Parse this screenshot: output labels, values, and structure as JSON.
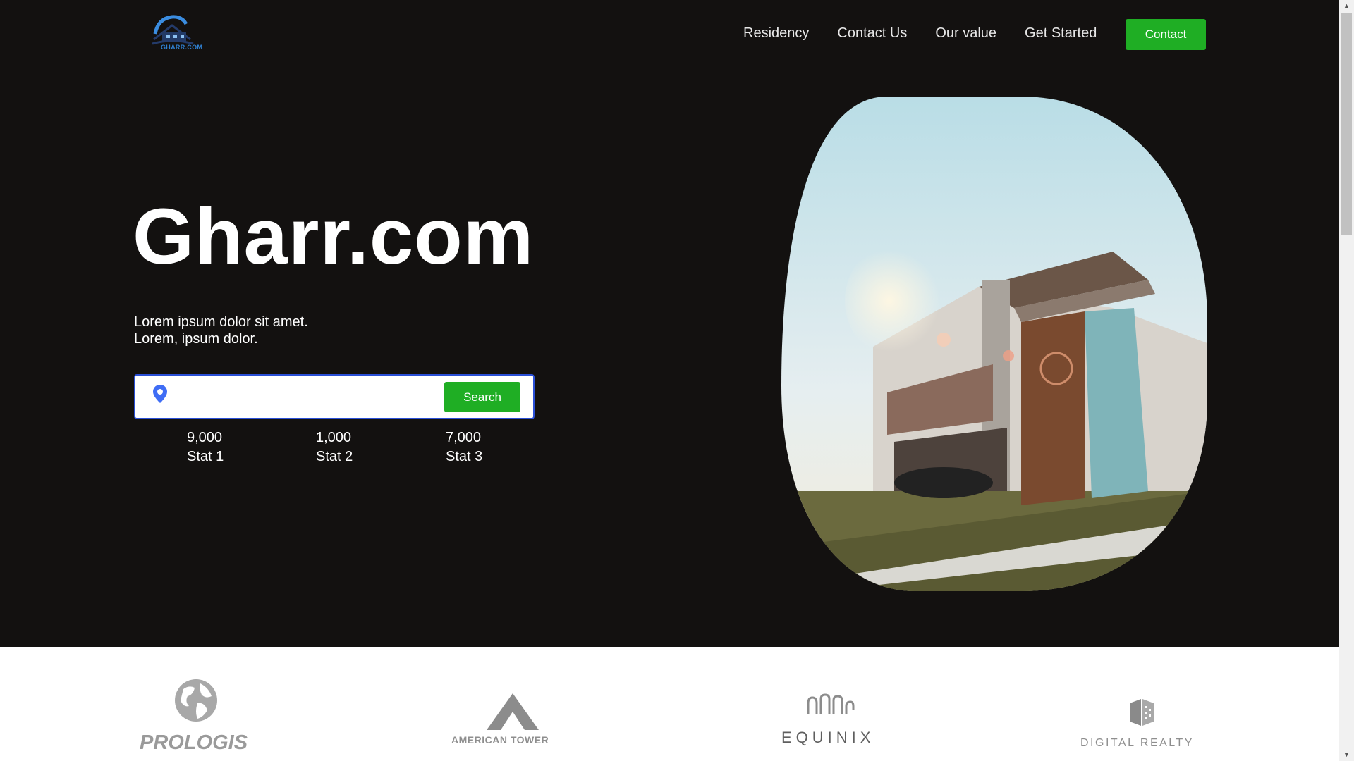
{
  "header": {
    "logo_text": "GHARR.COM",
    "nav": [
      "Residency",
      "Contact Us",
      "Our value",
      "Get Started"
    ],
    "cta_label": "Contact"
  },
  "hero": {
    "title": "Gharr.com",
    "tagline_line1": "Lorem ipsum dolor sit amet.",
    "tagline_line2": "Lorem, ipsum dolor.",
    "search": {
      "value": "",
      "placeholder": "",
      "button_label": "Search"
    },
    "stats": [
      {
        "value": "9,000",
        "label": "Stat 1"
      },
      {
        "value": "1,000",
        "label": "Stat 2"
      },
      {
        "value": "7,000",
        "label": "Stat 3"
      }
    ],
    "image_icon": "modern-house-photo"
  },
  "partners": [
    {
      "name": "PROLOGIS",
      "icon": "globe-icon"
    },
    {
      "name": "AMERICAN TOWER",
      "icon": "tower-icon"
    },
    {
      "name": "EQUINIX",
      "icon": "equinix-wave-icon"
    },
    {
      "name": "DIGITAL REALTY",
      "icon": "digital-realty-cube-icon"
    }
  ],
  "colors": {
    "hero_background": "#131110",
    "accent_green": "#1fae24",
    "search_border": "#2a4fd6",
    "pin_blue": "#3f6df5",
    "logo_blue": "#2f7fd0"
  }
}
